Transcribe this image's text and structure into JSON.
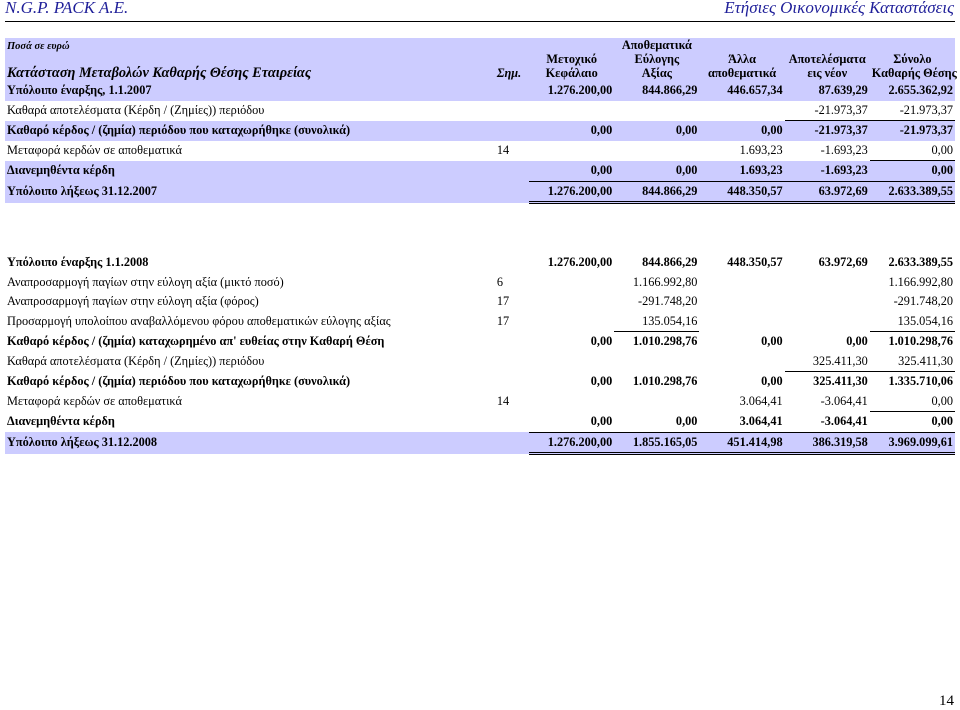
{
  "header": {
    "company": "N.G.P. PACK A.E.",
    "doc_title": "Ετήσιες Οικονομικές Καταστάσεις"
  },
  "table": {
    "currency_note": "Ποσά σε ευρώ",
    "statement_title": "Κατάσταση Μεταβολών Καθαρής Θέσης Εταιρείας",
    "note_header": "Σημ.",
    "columns": [
      [
        "Μετοχικό",
        "Κεφάλαιο"
      ],
      [
        "Αποθεματικά",
        "Εύλογης",
        "Αξίας"
      ],
      [
        "Άλλα",
        "αποθεματικά"
      ],
      [
        "Αποτελέσματα",
        "εις νέον"
      ],
      [
        "Σύνολο",
        "Καθαρής Θέσης"
      ]
    ],
    "rows_2007": [
      {
        "label": "Υπόλοιπο έναρξης, 1.1.2007",
        "note": "",
        "values": [
          "1.276.200,00",
          "844.866,29",
          "446.657,34",
          "87.639,29",
          "2.655.362,92"
        ]
      },
      {
        "label": "Καθαρά αποτελέσματα (Κέρδη / (Ζημίες)) περιόδου",
        "note": "",
        "values": [
          "",
          "",
          "",
          "-21.973,37",
          "-21.973,37"
        ]
      },
      {
        "label": "Καθαρό κέρδος / (ζημία) περιόδου που καταχωρήθηκε (συνολικά)",
        "note": "",
        "values": [
          "0,00",
          "0,00",
          "0,00",
          "-21.973,37",
          "-21.973,37"
        ]
      },
      {
        "label": "Μεταφορά κερδών σε αποθεματικά",
        "note": "14",
        "values": [
          "",
          "",
          "1.693,23",
          "-1.693,23",
          "0,00"
        ]
      },
      {
        "label": "Διανεμηθέντα κέρδη",
        "note": "",
        "values": [
          "0,00",
          "0,00",
          "1.693,23",
          "-1.693,23",
          "0,00"
        ]
      },
      {
        "label": "Υπόλοιπο λήξεως 31.12.2007",
        "note": "",
        "values": [
          "1.276.200,00",
          "844.866,29",
          "448.350,57",
          "63.972,69",
          "2.633.389,55"
        ]
      }
    ],
    "rows_2008": [
      {
        "label": "Υπόλοιπο έναρξης 1.1.2008",
        "note": "",
        "values": [
          "1.276.200,00",
          "844.866,29",
          "448.350,57",
          "63.972,69",
          "2.633.389,55"
        ]
      },
      {
        "label": "Αναπροσαρμογή παγίων στην εύλογη αξία (μικτό ποσό)",
        "note": "6",
        "values": [
          "",
          "1.166.992,80",
          "",
          "",
          "1.166.992,80"
        ]
      },
      {
        "label": "Αναπροσαρμογή παγίων στην εύλογη αξία (φόρος)",
        "note": "17",
        "values": [
          "",
          "-291.748,20",
          "",
          "",
          "-291.748,20"
        ]
      },
      {
        "label": "Προσαρμογή υπολοίπου αναβαλλόμενου φόρου αποθεματικών εύλογης αξίας",
        "note": "17",
        "values": [
          "",
          "135.054,16",
          "",
          "",
          "135.054,16"
        ]
      },
      {
        "label": "Καθαρό κέρδος / (ζημία) καταχωρημένο απ' ευθείας στην Καθαρή Θέση",
        "note": "",
        "values": [
          "0,00",
          "1.010.298,76",
          "0,00",
          "0,00",
          "1.010.298,76"
        ]
      },
      {
        "label": "Καθαρά αποτελέσματα (Κέρδη / (Ζημίες)) περιόδου",
        "note": "",
        "values": [
          "",
          "",
          "",
          "325.411,30",
          "325.411,30"
        ]
      },
      {
        "label": "Καθαρό κέρδος / (ζημία) περιόδου που καταχωρήθηκε (συνολικά)",
        "note": "",
        "values": [
          "0,00",
          "1.010.298,76",
          "0,00",
          "325.411,30",
          "1.335.710,06"
        ]
      },
      {
        "label": "Μεταφορά κερδών σε αποθεματικά",
        "note": "14",
        "values": [
          "",
          "",
          "3.064,41",
          "-3.064,41",
          "0,00"
        ]
      },
      {
        "label": "Διανεμηθέντα κέρδη",
        "note": "",
        "values": [
          "0,00",
          "0,00",
          "3.064,41",
          "-3.064,41",
          "0,00"
        ]
      },
      {
        "label": "Υπόλοιπο λήξεως 31.12.2008",
        "note": "",
        "values": [
          "1.276.200,00",
          "1.855.165,05",
          "451.414,98",
          "386.319,58",
          "3.969.099,61"
        ]
      }
    ]
  },
  "footer": {
    "page_number": "14"
  }
}
